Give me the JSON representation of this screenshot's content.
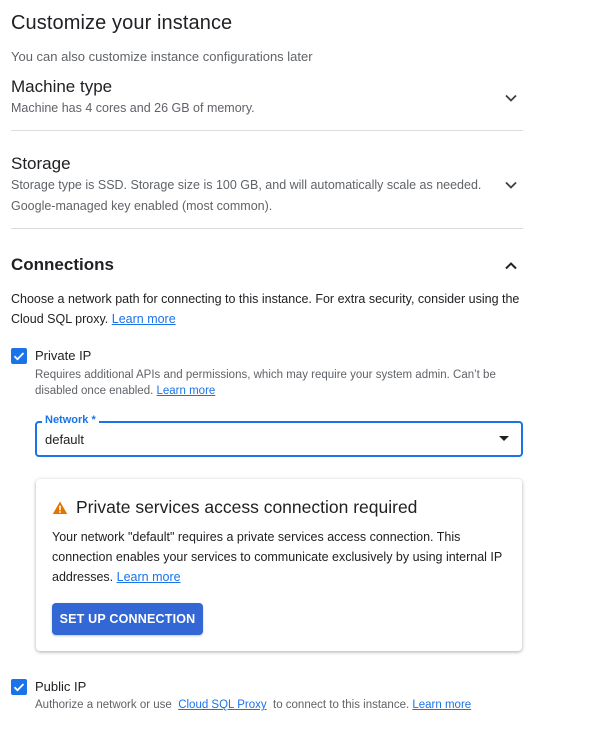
{
  "header": {
    "title": "Customize your instance",
    "subtitle": "You can also customize instance configurations later"
  },
  "machine_type": {
    "title": "Machine type",
    "description": "Machine has 4 cores and 26 GB of memory.",
    "expanded": false
  },
  "storage": {
    "title": "Storage",
    "description_line1": "Storage type is SSD. Storage size is 100 GB, and will automatically scale as needed.",
    "description_line2": "Google-managed key enabled (most common).",
    "expanded": false
  },
  "connections": {
    "title": "Connections",
    "expanded": true,
    "intro": "Choose a network path for connecting to this instance. For extra security, consider using the Cloud SQL proxy.",
    "intro_link": "Learn more",
    "private_ip": {
      "label": "Private IP",
      "checked": true,
      "description": "Requires additional APIs and permissions, which may require your system admin. Can’t be disabled once enabled.",
      "link": "Learn more"
    },
    "network": {
      "label": "Network *",
      "value": "default"
    },
    "alert": {
      "icon": "warning-icon",
      "title": "Private services access connection required",
      "text": "Your network \"default\" requires a private services access connection. This connection enables your services to communicate exclusively by using internal IP addresses.",
      "link": "Learn more",
      "button": "SET UP CONNECTION"
    },
    "public_ip": {
      "label": "Public IP",
      "checked": true,
      "desc_prefix": "Authorize a network or use",
      "proxy_link": "Cloud SQL Proxy",
      "desc_suffix": "to connect to this instance.",
      "link": "Learn more"
    }
  },
  "colors": {
    "accent": "#1a73e8",
    "button": "#3367d6",
    "warning": "#e37400",
    "divider": "#dadce0"
  }
}
